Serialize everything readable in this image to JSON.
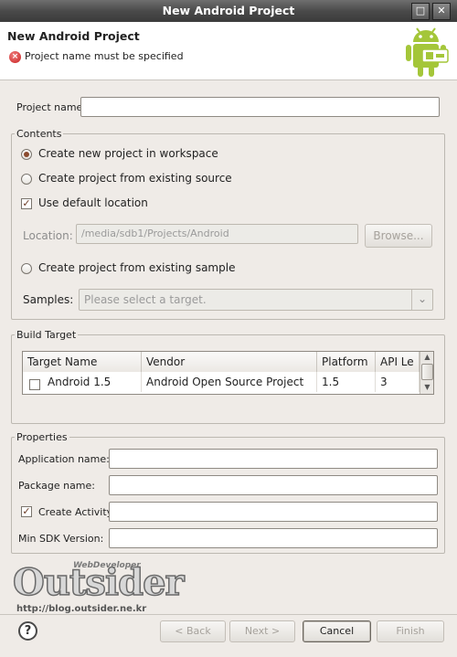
{
  "window": {
    "title": "New Android Project"
  },
  "header": {
    "title": "New Android Project",
    "error_message": "Project name must be specified",
    "error_icon": "error-x-icon",
    "logo_icon": "android-robot-icon",
    "accent_color": "#a4c639"
  },
  "project_name": {
    "label": "Project name:",
    "value": ""
  },
  "contents": {
    "legend": "Contents",
    "radio_new": "Create new project in workspace",
    "radio_existing_source": "Create project from existing source",
    "use_default_location": "Use default location",
    "location_label": "Location:",
    "location_value": "/media/sdb1/Projects/Android",
    "browse_label": "Browse...",
    "radio_existing_sample": "Create project from existing sample",
    "samples_label": "Samples:",
    "samples_placeholder": "Please select a target."
  },
  "build_target": {
    "legend": "Build Target",
    "columns": [
      "Target Name",
      "Vendor",
      "Platform",
      "API Le"
    ],
    "rows": [
      {
        "name": "Android 1.5",
        "vendor": "Android Open Source Project",
        "platform": "1.5",
        "api": "3"
      }
    ]
  },
  "properties": {
    "legend": "Properties",
    "application_name": "Application name:",
    "package_name": "Package name:",
    "create_activity": "Create Activity:",
    "min_sdk": "Min SDK Version:"
  },
  "watermark": {
    "brand": "Outsider",
    "tagline": "WebDeveloper",
    "url": "http://blog.outsider.ne.kr"
  },
  "footer": {
    "back": "< Back",
    "next": "Next >",
    "cancel": "Cancel",
    "finish": "Finish"
  }
}
